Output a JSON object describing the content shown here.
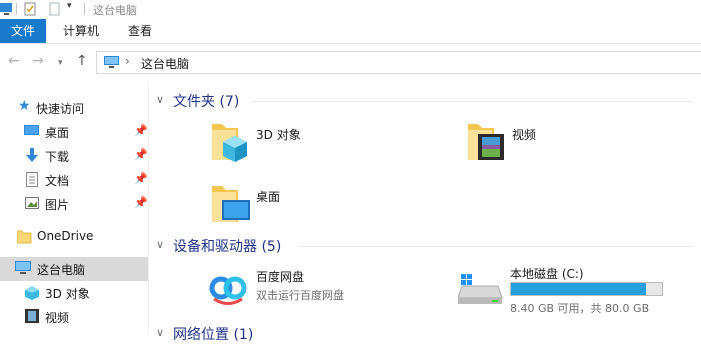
{
  "window": {
    "title": "这台电脑"
  },
  "ribbon": {
    "tabs": [
      "文件",
      "计算机",
      "查看"
    ]
  },
  "address": {
    "path": "这台电脑"
  },
  "navpane": {
    "quick_access": "快速访问",
    "quick_items": [
      "桌面",
      "下载",
      "文档",
      "图片"
    ],
    "onedrive": "OneDrive",
    "this_pc": "这台电脑",
    "pc_children": [
      "3D 对象",
      "视频"
    ]
  },
  "folders": {
    "header": "文件夹 (7)",
    "items": [
      "3D 对象",
      "视频",
      "桌面"
    ]
  },
  "devices": {
    "header": "设备和驱动器 (5)",
    "baidu": {
      "name": "百度网盘",
      "sub": "双击运行百度网盘"
    },
    "local_disk": {
      "name": "本地磁盘 (C:)",
      "space": "8.40 GB 可用，共 80.0 GB",
      "used_fraction": 0.895
    }
  },
  "network": {
    "header": "网络位置 (1)"
  },
  "colors": {
    "accent": "#1979ca",
    "header_text": "#1e3287",
    "drive_fill": "#26a0da",
    "selected_bg": "#d9d9d9"
  }
}
